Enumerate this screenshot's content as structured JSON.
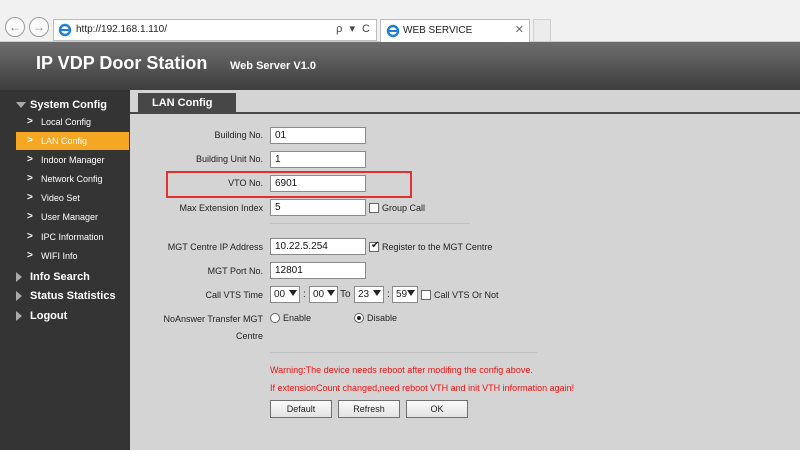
{
  "browser": {
    "url": "http://192.168.1.110/",
    "tab_title": "WEB SERVICE",
    "address_tools": "ρ ▾ C",
    "tab_close": "✕"
  },
  "header": {
    "title": "IP VDP Door Station",
    "version": "Web Server V1.0"
  },
  "sidebar": {
    "system_config": "System Config",
    "items": [
      {
        "label": "Local Config"
      },
      {
        "label": "LAN Config"
      },
      {
        "label": "Indoor Manager"
      },
      {
        "label": "Network Config"
      },
      {
        "label": "Video Set"
      },
      {
        "label": "User Manager"
      },
      {
        "label": "IPC Information"
      },
      {
        "label": "WIFI Info"
      }
    ],
    "info_search": "Info Search",
    "status_statistics": "Status Statistics",
    "logout": "Logout"
  },
  "content": {
    "tab": "LAN Config",
    "building_no": {
      "label": "Building No.",
      "value": "01"
    },
    "building_unit_no": {
      "label": "Building Unit No.",
      "value": "1"
    },
    "vto_no": {
      "label": "VTO No.",
      "value": "6901"
    },
    "max_ext_index": {
      "label": "Max Extension Index",
      "value": "5"
    },
    "group_call": {
      "label": "Group Call",
      "checked": false
    },
    "mgt_ip": {
      "label": "MGT Centre IP Address",
      "value": "10.22.5.254"
    },
    "register_mgt": {
      "label": "Register to the MGT Centre",
      "checked": true
    },
    "mgt_port": {
      "label": "MGT Port No.",
      "value": "12801"
    },
    "call_vts_time": {
      "label": "Call VTS Time",
      "from_h": "00",
      "from_m": "00",
      "to_label": "To",
      "to_h": "23",
      "to_m": "59",
      "colon": ":"
    },
    "call_vts_or_not": {
      "label": "Call VTS Or Not",
      "checked": false
    },
    "noanswer": {
      "label_line1": "NoAnswer Transfer MGT",
      "label_line2": "Centre",
      "enable": "Enable",
      "disable": "Disable",
      "selected": "Disable"
    },
    "warning1": "Warning:The device needs reboot after modifing the config above.",
    "warning2": "If extensionCount changed,need reboot VTH and init VTH information again!",
    "buttons": {
      "default": "Default",
      "refresh": "Refresh",
      "ok": "OK"
    }
  },
  "colors": {
    "active_item": "#f5a623",
    "highlight": "#e03030",
    "warning_text": "#e11111"
  }
}
